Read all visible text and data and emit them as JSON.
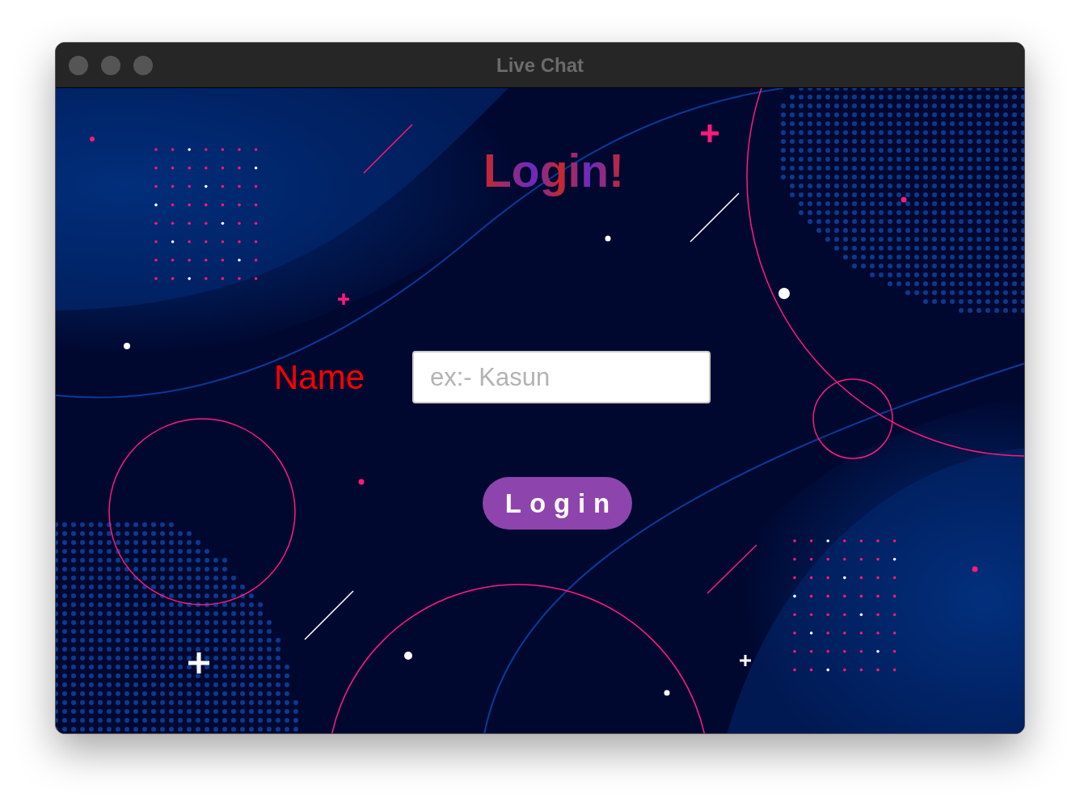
{
  "window": {
    "title": "Live Chat"
  },
  "heading": "Login!",
  "form": {
    "label": "Name",
    "placeholder": "ex:- Kasun"
  },
  "button": "Login"
}
